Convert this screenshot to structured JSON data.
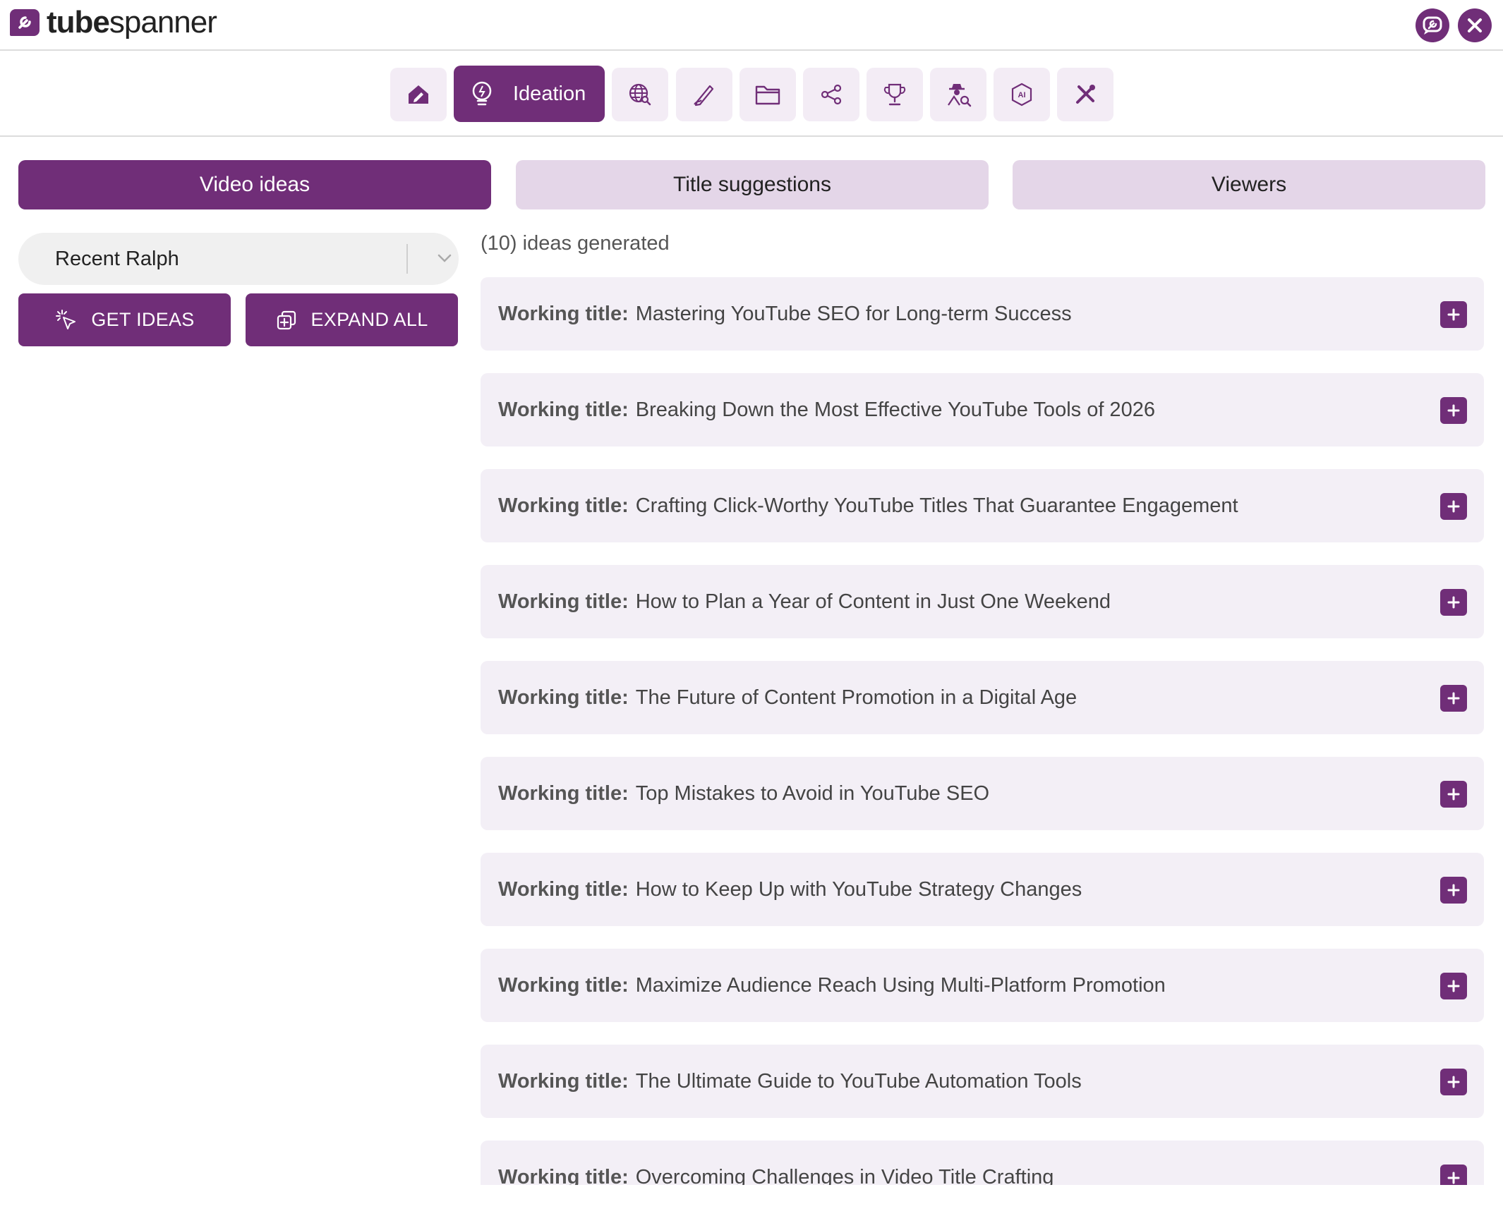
{
  "app": {
    "logo_bold": "tube",
    "logo_light": "spanner"
  },
  "toolbar": {
    "items": [
      {
        "icon": "home-edit-icon",
        "label": ""
      },
      {
        "icon": "lightbulb-icon",
        "label": "Ideation",
        "active": true
      },
      {
        "icon": "globe-search-icon",
        "label": ""
      },
      {
        "icon": "pen-icon",
        "label": ""
      },
      {
        "icon": "folder-icon",
        "label": ""
      },
      {
        "icon": "share-icon",
        "label": ""
      },
      {
        "icon": "trophy-icon",
        "label": ""
      },
      {
        "icon": "spy-search-icon",
        "label": ""
      },
      {
        "icon": "ai-chip-icon",
        "label": ""
      },
      {
        "icon": "tools-icon",
        "label": ""
      }
    ]
  },
  "tabs": [
    {
      "label": "Video ideas",
      "active": true
    },
    {
      "label": "Title suggestions",
      "active": false
    },
    {
      "label": "Viewers",
      "active": false
    }
  ],
  "filter": {
    "selected": "Recent Ralph"
  },
  "buttons": {
    "get_ideas": "GET IDEAS",
    "expand_all": "EXPAND ALL"
  },
  "ideas": {
    "count_text": "(10) ideas generated",
    "label": "Working title:",
    "items": [
      "Mastering YouTube SEO for Long-term Success",
      "Breaking Down the Most Effective YouTube Tools of 2026",
      "Crafting Click-Worthy YouTube Titles That Guarantee Engagement",
      "How to Plan a Year of Content in Just One Weekend",
      "The Future of Content Promotion in a Digital Age",
      "Top Mistakes to Avoid in YouTube SEO",
      "How to Keep Up with YouTube Strategy Changes",
      "Maximize Audience Reach Using Multi-Platform Promotion",
      "The Ultimate Guide to YouTube Automation Tools",
      "Overcoming Challenges in Video Title Crafting"
    ]
  },
  "colors": {
    "brand": "#702e78",
    "tab_inactive": "#e4d6e8",
    "card_bg": "#f3eff6"
  }
}
